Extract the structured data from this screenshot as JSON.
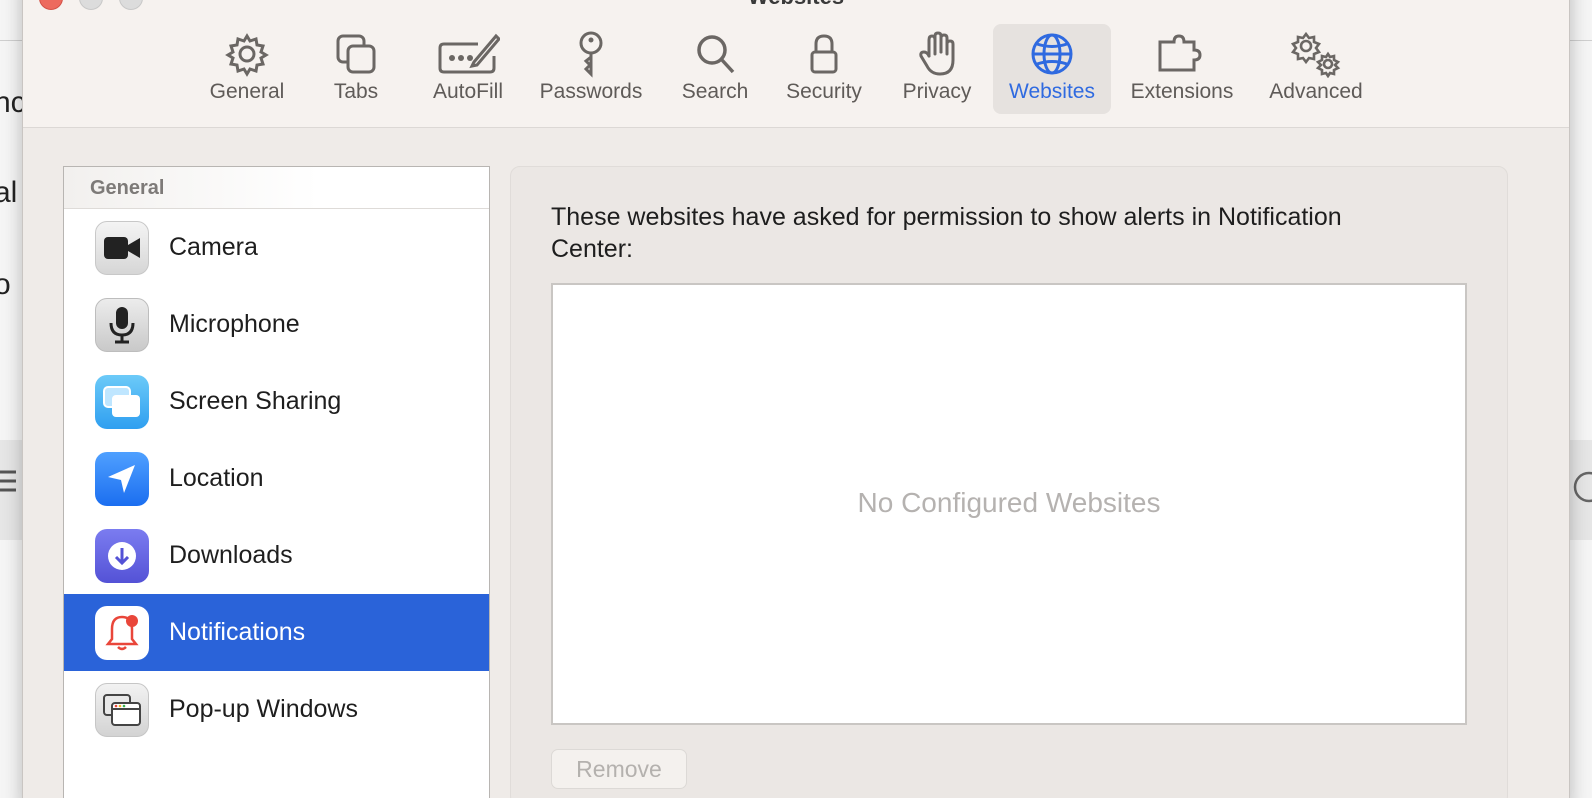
{
  "background": {
    "fragments": [
      "nc",
      "al",
      "o"
    ]
  },
  "window": {
    "title": "Websites"
  },
  "toolbar": {
    "tabs": [
      {
        "label": "General",
        "icon": "gear-icon"
      },
      {
        "label": "Tabs",
        "icon": "tabs-icon"
      },
      {
        "label": "AutoFill",
        "icon": "autofill-icon"
      },
      {
        "label": "Passwords",
        "icon": "key-icon"
      },
      {
        "label": "Search",
        "icon": "search-icon"
      },
      {
        "label": "Security",
        "icon": "lock-icon"
      },
      {
        "label": "Privacy",
        "icon": "hand-icon"
      },
      {
        "label": "Websites",
        "icon": "globe-icon",
        "active": true
      },
      {
        "label": "Extensions",
        "icon": "puzzle-icon"
      },
      {
        "label": "Advanced",
        "icon": "gears-icon"
      }
    ],
    "accent_color": "#2f6ae0"
  },
  "sidebar": {
    "header": "General",
    "items": [
      {
        "label": "Camera",
        "icon": "camera-icon"
      },
      {
        "label": "Microphone",
        "icon": "microphone-icon"
      },
      {
        "label": "Screen Sharing",
        "icon": "screen-sharing-icon"
      },
      {
        "label": "Location",
        "icon": "location-icon"
      },
      {
        "label": "Downloads",
        "icon": "downloads-icon"
      },
      {
        "label": "Notifications",
        "icon": "notifications-icon",
        "selected": true
      },
      {
        "label": "Pop-up Windows",
        "icon": "popup-windows-icon"
      }
    ],
    "selected_color": "#2a63d9"
  },
  "content": {
    "description": "These websites have asked for permission to show alerts in Notification Center:",
    "empty_state": "No Configured Websites",
    "remove_label": "Remove"
  }
}
